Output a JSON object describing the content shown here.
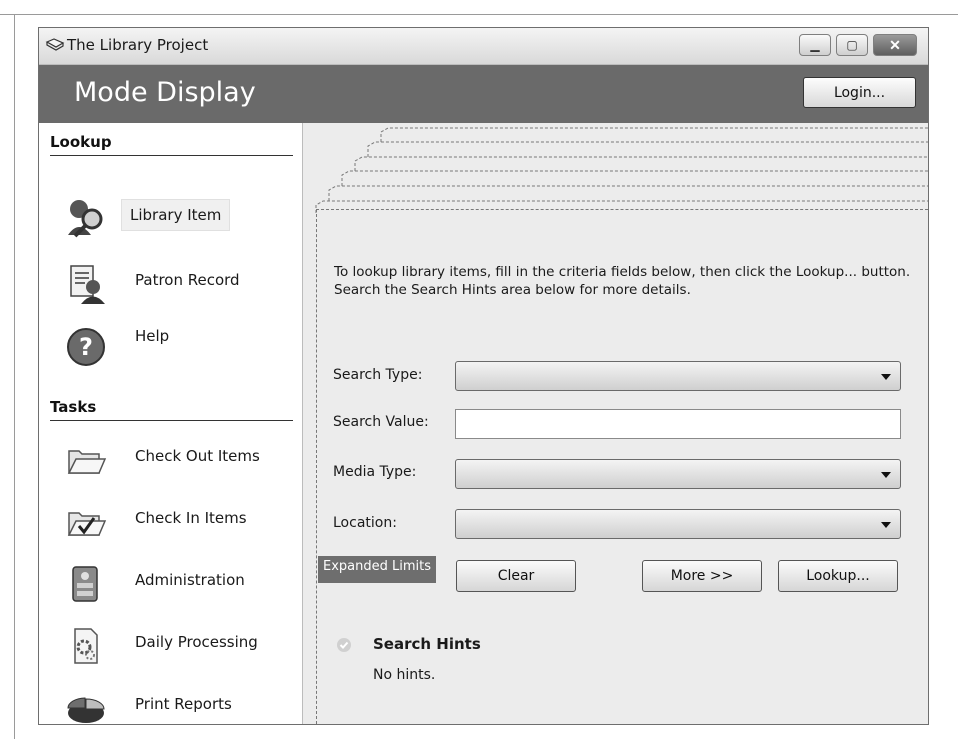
{
  "window": {
    "title": "The Library Project"
  },
  "header": {
    "mode_title": "Mode Display",
    "login_label": "Login..."
  },
  "sidebar": {
    "lookup_heading": "Lookup",
    "lookup_items": [
      {
        "label": "Library Item",
        "icon": "search-magnifier-icon"
      },
      {
        "label": "Patron Record",
        "icon": "patron-record-icon"
      },
      {
        "label": "Help",
        "icon": "help-icon"
      }
    ],
    "tasks_heading": "Tasks",
    "task_items": [
      {
        "label": "Check Out Items",
        "icon": "open-folder-icon"
      },
      {
        "label": "Check In Items",
        "icon": "checked-folder-icon"
      },
      {
        "label": "Administration",
        "icon": "administration-icon"
      },
      {
        "label": "Daily Processing",
        "icon": "daily-processing-icon"
      },
      {
        "label": "Print Reports",
        "icon": "pie-chart-icon"
      }
    ]
  },
  "main": {
    "intro_text": "To lookup library items, fill in the criteria fields below, then click the Lookup... button. Search the Search Hints area below for more details.",
    "fields": {
      "search_type_label": "Search Type:",
      "search_value_label": "Search Value:",
      "media_type_label": "Media Type:",
      "location_label": "Location:"
    },
    "expanded_limits": "Expanded Limits",
    "buttons": {
      "clear": "Clear",
      "more": "More >>",
      "lookup": "Lookup..."
    },
    "hints": {
      "title": "Search Hints",
      "text": "No hints."
    }
  }
}
